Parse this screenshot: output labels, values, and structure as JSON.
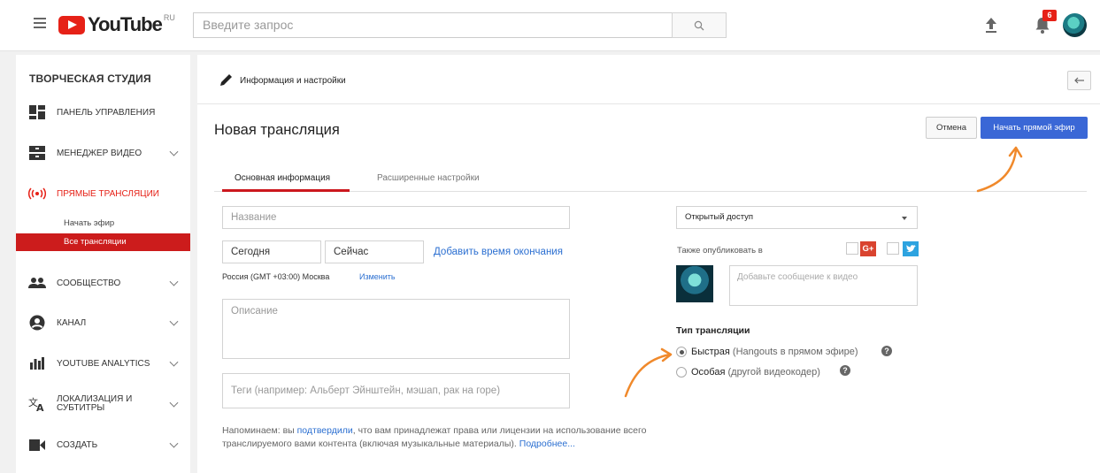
{
  "header": {
    "logo_text": "YouTube",
    "logo_region": "RU",
    "search_placeholder": "Введите запрос",
    "notification_count": "6"
  },
  "sidebar": {
    "title": "ТВОРЧЕСКАЯ СТУДИЯ",
    "items": [
      {
        "label": "ПАНЕЛЬ УПРАВЛЕНИЯ",
        "icon": "dashboard-icon"
      },
      {
        "label": "МЕНЕДЖЕР ВИДЕО",
        "icon": "video-manager-icon"
      },
      {
        "label": "ПРЯМЫЕ ТРАНСЛЯЦИИ",
        "icon": "live-icon"
      },
      {
        "label": "СООБЩЕСТВО",
        "icon": "community-icon"
      },
      {
        "label": "КАНАЛ",
        "icon": "channel-icon"
      },
      {
        "label": "YOUTUBE ANALYTICS",
        "icon": "analytics-icon"
      },
      {
        "label": "ЛОКАЛИЗАЦИЯ И СУБТИТРЫ",
        "icon": "translate-icon"
      },
      {
        "label": "СОЗДАТЬ",
        "icon": "create-icon"
      }
    ],
    "sub_items": [
      {
        "label": "Начать эфир"
      },
      {
        "label": "Все трансляции"
      }
    ]
  },
  "main": {
    "topbar_title": "Информация и настройки",
    "page_title": "Новая трансляция",
    "cancel_label": "Отмена",
    "start_label": "Начать прямой эфир",
    "tabs": [
      {
        "label": "Основная информация"
      },
      {
        "label": "Расширенные настройки"
      }
    ],
    "form": {
      "title_placeholder": "Название",
      "date_value": "Сегодня",
      "time_value": "Сейчас",
      "add_end_time": "Добавить время окончания",
      "timezone": "Россия (GMT +03:00) Москва",
      "change_link": "Изменить",
      "description_placeholder": "Описание",
      "tags_placeholder": "Теги (например: Альберт Эйнштейн, мэшап, рак на горе)",
      "note_before": "Напоминаем: вы ",
      "note_link": "подтвердили",
      "note_after": ", что вам принадлежат права или лицензии на использование всего транслируемого вами контента (включая музыкальные материалы). ",
      "note_more": "Подробнее..."
    },
    "right": {
      "privacy_value": "Открытый доступ",
      "also_publish": "Также опубликовать в",
      "gplus_label": "G+",
      "message_placeholder": "Добавьте сообщение к видео",
      "type_title": "Тип трансляции",
      "option_fast": "Быстрая",
      "option_fast_note": "(Hangouts в прямом эфире)",
      "option_custom": "Особая",
      "option_custom_note": "(другой видеокодер)",
      "help_glyph": "?"
    }
  },
  "colors": {
    "brand_red": "#e62117",
    "primary_blue": "#3a67d6",
    "annotation_orange": "#f0892b"
  }
}
